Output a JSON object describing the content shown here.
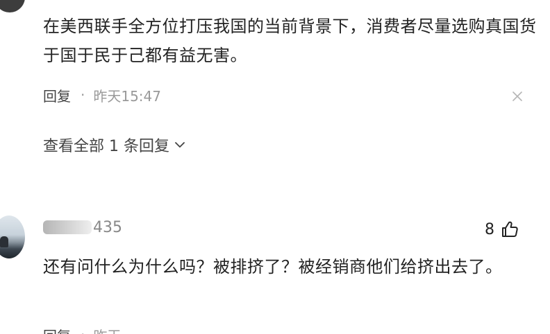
{
  "comments": [
    {
      "text": "在美西联手全方位打压我国的当前背景下，消费者尽量选购真国货于国于民于己都有益无害。",
      "reply_label": "回复",
      "separator": "·",
      "time": "昨天15:47",
      "view_all_replies": "查看全部 1 条回复"
    },
    {
      "username_visible_tail": "435",
      "likes": "8",
      "text": "还有问什么为什么吗？被排挤了？被经销商他们给挤出去了。",
      "reply_label": "回复",
      "separator": "·",
      "time": "昨天"
    }
  ],
  "colors": {
    "text": "#222222",
    "meta": "#999999",
    "icon": "#333333"
  },
  "icons": {
    "close": "close-icon",
    "chevron": "chevron-down-icon",
    "like": "thumbs-up-icon"
  }
}
